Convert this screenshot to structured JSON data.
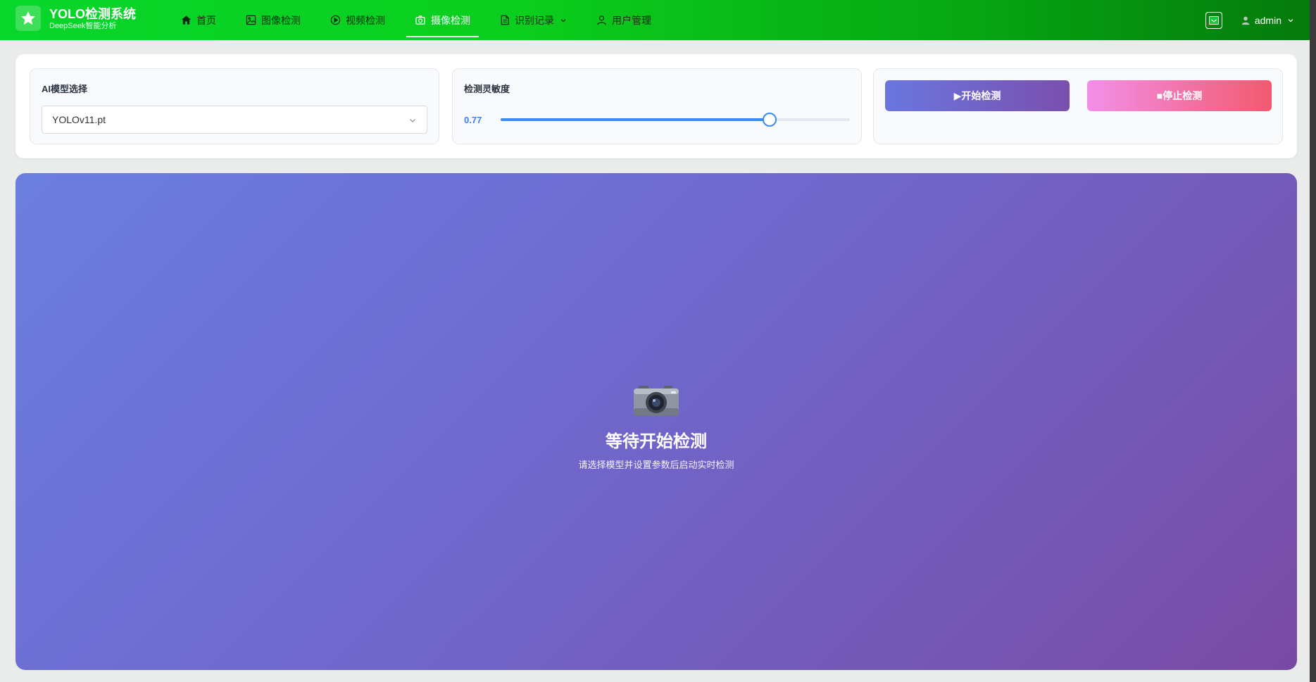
{
  "header": {
    "brand_title": "YOLO检测系统",
    "brand_subtitle": "DeepSeek智能分析",
    "nav": [
      {
        "label": "首页",
        "icon": "home-icon",
        "active": false
      },
      {
        "label": "图像检测",
        "icon": "image-icon",
        "active": false
      },
      {
        "label": "视频检测",
        "icon": "play-circle-icon",
        "active": false
      },
      {
        "label": "摄像检测",
        "icon": "camera-icon",
        "active": true
      },
      {
        "label": "识别记录",
        "icon": "document-icon",
        "active": false,
        "dropdown": true
      },
      {
        "label": "用户管理",
        "icon": "user-icon",
        "active": false
      }
    ],
    "username": "admin"
  },
  "controls": {
    "model_label": "AI模型选择",
    "model_value": "YOLOv11.pt",
    "sensitivity_label": "检测灵敏度",
    "sensitivity_value": "0.77",
    "sensitivity_level": 0.77,
    "start_button": "▶开始检测",
    "stop_button": "■停止检测"
  },
  "video": {
    "status_title": "等待开始检测",
    "status_hint": "请选择模型并设置参数后启动实时检测"
  },
  "colors": {
    "header_green": "#08d62a",
    "accent_blue": "#3b8bf0",
    "start_gradient": [
      "#6a77df",
      "#7a4fae"
    ],
    "stop_gradient": [
      "#f38fe8",
      "#f25a6e"
    ],
    "video_gradient": [
      "#6b7ee0",
      "#794aa4"
    ]
  }
}
